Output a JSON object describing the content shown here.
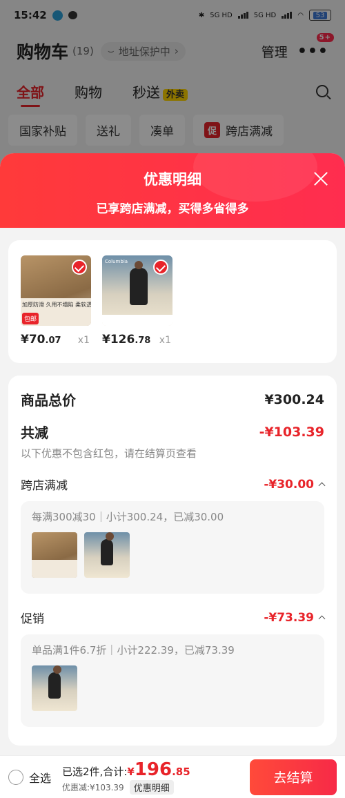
{
  "status_bar": {
    "time": "15:42",
    "net1": "5G HD",
    "net2": "5G HD",
    "battery": "53"
  },
  "cart": {
    "title": "购物车",
    "count": "(19)",
    "address_protect": "地址保护中",
    "manage": "管理",
    "menu_badge": "5+"
  },
  "tabs": [
    {
      "label": "全部"
    },
    {
      "label": "购物"
    },
    {
      "label": "秒送",
      "tag": "外卖"
    }
  ],
  "chips": [
    {
      "label": "国家补贴"
    },
    {
      "label": "送礼"
    },
    {
      "label": "凑单"
    },
    {
      "label": "跨店满减",
      "tag": "促"
    }
  ],
  "sheet": {
    "title": "优惠明细",
    "subtitle": "已享跨店满减，买得多省得多"
  },
  "products": [
    {
      "price_int": "¥70",
      "price_dec": ".07",
      "qty": "x1",
      "image_caption": "加厚防滑  久用不塌陷  柔软透气",
      "image_badge": "包邮"
    },
    {
      "price_int": "¥126",
      "price_dec": ".78",
      "qty": "x1",
      "image_logo": "Columbia"
    }
  ],
  "summary": {
    "total_label": "商品总价",
    "total_value": "¥300.24",
    "reduce_label": "共减",
    "reduce_value": "-¥103.39",
    "note": "以下优惠不包含红包，请在结算页查看",
    "cross_store": {
      "label": "跨店满减",
      "value": "-¥30.00",
      "detail": "每满300减30｜小计300.24，已减30.00"
    },
    "promo": {
      "label": "促销",
      "value": "-¥73.39",
      "detail": "单品满1件6.7折｜小计222.39，已减73.39"
    }
  },
  "bottom": {
    "select_all": "全选",
    "selected_text": "已选2件,合计:",
    "total_yen": "¥",
    "total_int": "196",
    "total_dec": ".85",
    "discount_text": "优惠减:¥103.39",
    "detail_btn": "优惠明细",
    "checkout": "去结算"
  },
  "colors": {
    "accent": "#e8242a",
    "gradient_start": "#ff3a3a",
    "gradient_end": "#ff2d4f"
  }
}
